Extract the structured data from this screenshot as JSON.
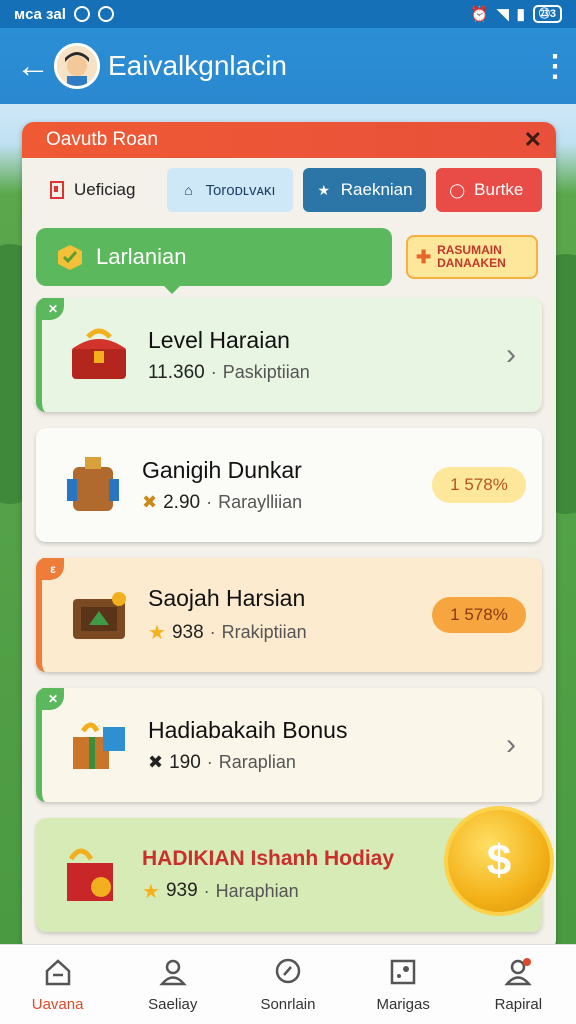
{
  "status_bar": {
    "carrier": "ᴍᴄa ɜal",
    "battery": "㉓3"
  },
  "app_bar": {
    "back": "←",
    "title": "Eaivalkgnlacin",
    "menu": "⋮"
  },
  "panel": {
    "title": "Oavutb Roan",
    "close": "✕",
    "tabs": [
      {
        "label": "Uefiᴄiag"
      },
      {
        "label": "Toroᴅʟvᴀᴋı"
      },
      {
        "label": "Raeknian"
      },
      {
        "label": "Buɾtke"
      }
    ],
    "section_label": "Larlanian",
    "section_badge": "RASUMAIN DANAAKEN"
  },
  "items": [
    {
      "title": "Level Haraian",
      "value": "11.360",
      "sub": "Paskiptiian",
      "action": "›"
    },
    {
      "title": "Ganigih Dunkar",
      "value": "2.90",
      "sub": "Raraylliian",
      "action": "1 578%"
    },
    {
      "title": "Saojah Harsian",
      "value": "938",
      "sub": "Rrakiptiian",
      "action": "1 578%"
    },
    {
      "title": "Hadiabakaih Bonus",
      "value": "190",
      "sub": "Raraplian",
      "action": "›"
    },
    {
      "title": "HADIKIAN Ishanh Hodiay",
      "value": "939",
      "sub": "Haraphian"
    }
  ],
  "bottom_nav": [
    {
      "label": "Uavana"
    },
    {
      "label": "Saeliay"
    },
    {
      "label": "Sonrlain"
    },
    {
      "label": "Marigas"
    },
    {
      "label": "Rapiral"
    }
  ],
  "colors": {
    "accent": "#2b8fd6",
    "header": "#ef5a34",
    "green": "#5cb85c",
    "orange": "#f07c3a"
  }
}
